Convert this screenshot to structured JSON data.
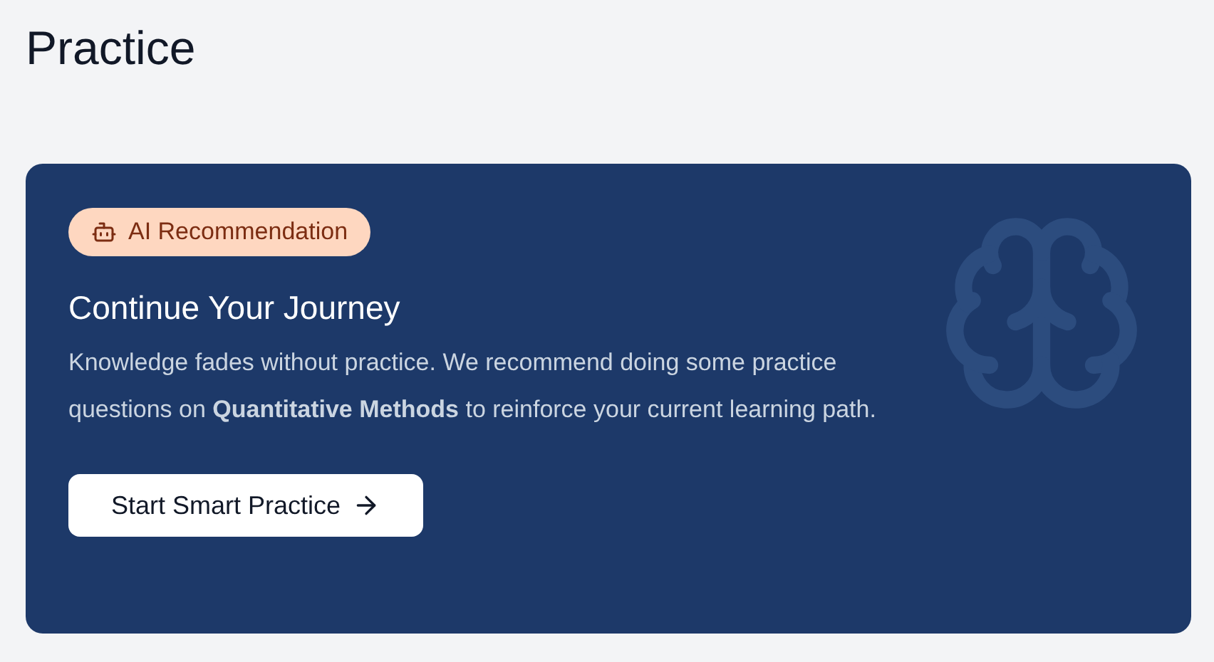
{
  "page_title": "Practice",
  "card": {
    "badge": "AI Recommendation",
    "heading": "Continue Your Journey",
    "body": "Knowledge fades without practice. We recommend doing some practice questions on **Quantitative Methods** to reinforce your current learning path.",
    "button": "Start Smart Practice"
  }
}
